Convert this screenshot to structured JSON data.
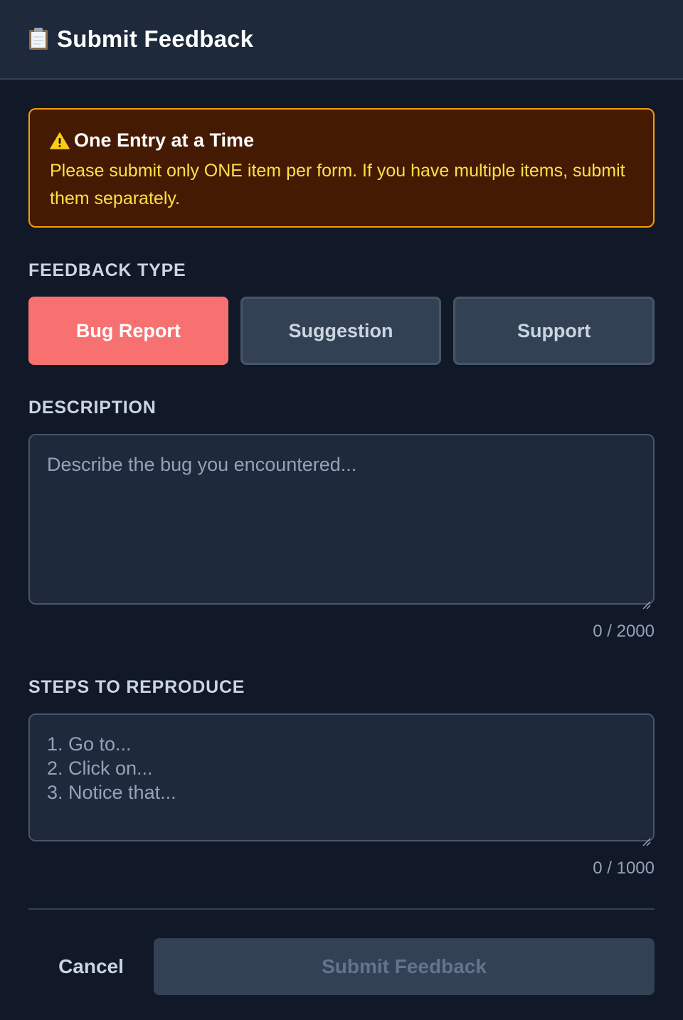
{
  "header": {
    "title": "Submit Feedback",
    "icon": "clipboard-icon"
  },
  "alert": {
    "icon": "warning-icon",
    "title": "One Entry at a Time",
    "body": "Please submit only ONE item per form. If you have multiple items, submit them separately."
  },
  "feedback_type": {
    "label": "FEEDBACK TYPE",
    "options": [
      {
        "label": "Bug Report",
        "selected": true
      },
      {
        "label": "Suggestion",
        "selected": false
      },
      {
        "label": "Support",
        "selected": false
      }
    ]
  },
  "description": {
    "label": "DESCRIPTION",
    "placeholder": "Describe the bug you encountered...",
    "value": "",
    "counter": "0 / 2000"
  },
  "steps": {
    "label": "STEPS TO REPRODUCE",
    "placeholder_lines": [
      "1. Go to...",
      "2. Click on...",
      "3. Notice that..."
    ],
    "value": "",
    "counter": "0 / 1000"
  },
  "footer": {
    "cancel_label": "Cancel",
    "submit_label": "Submit Feedback"
  },
  "colors": {
    "background": "#111827",
    "header_bg": "#1e293b",
    "alert_bg": "#451a03",
    "alert_border": "#f59e0b",
    "alert_text": "#fde047",
    "active_type": "#f87171",
    "inactive_type": "#334155"
  }
}
